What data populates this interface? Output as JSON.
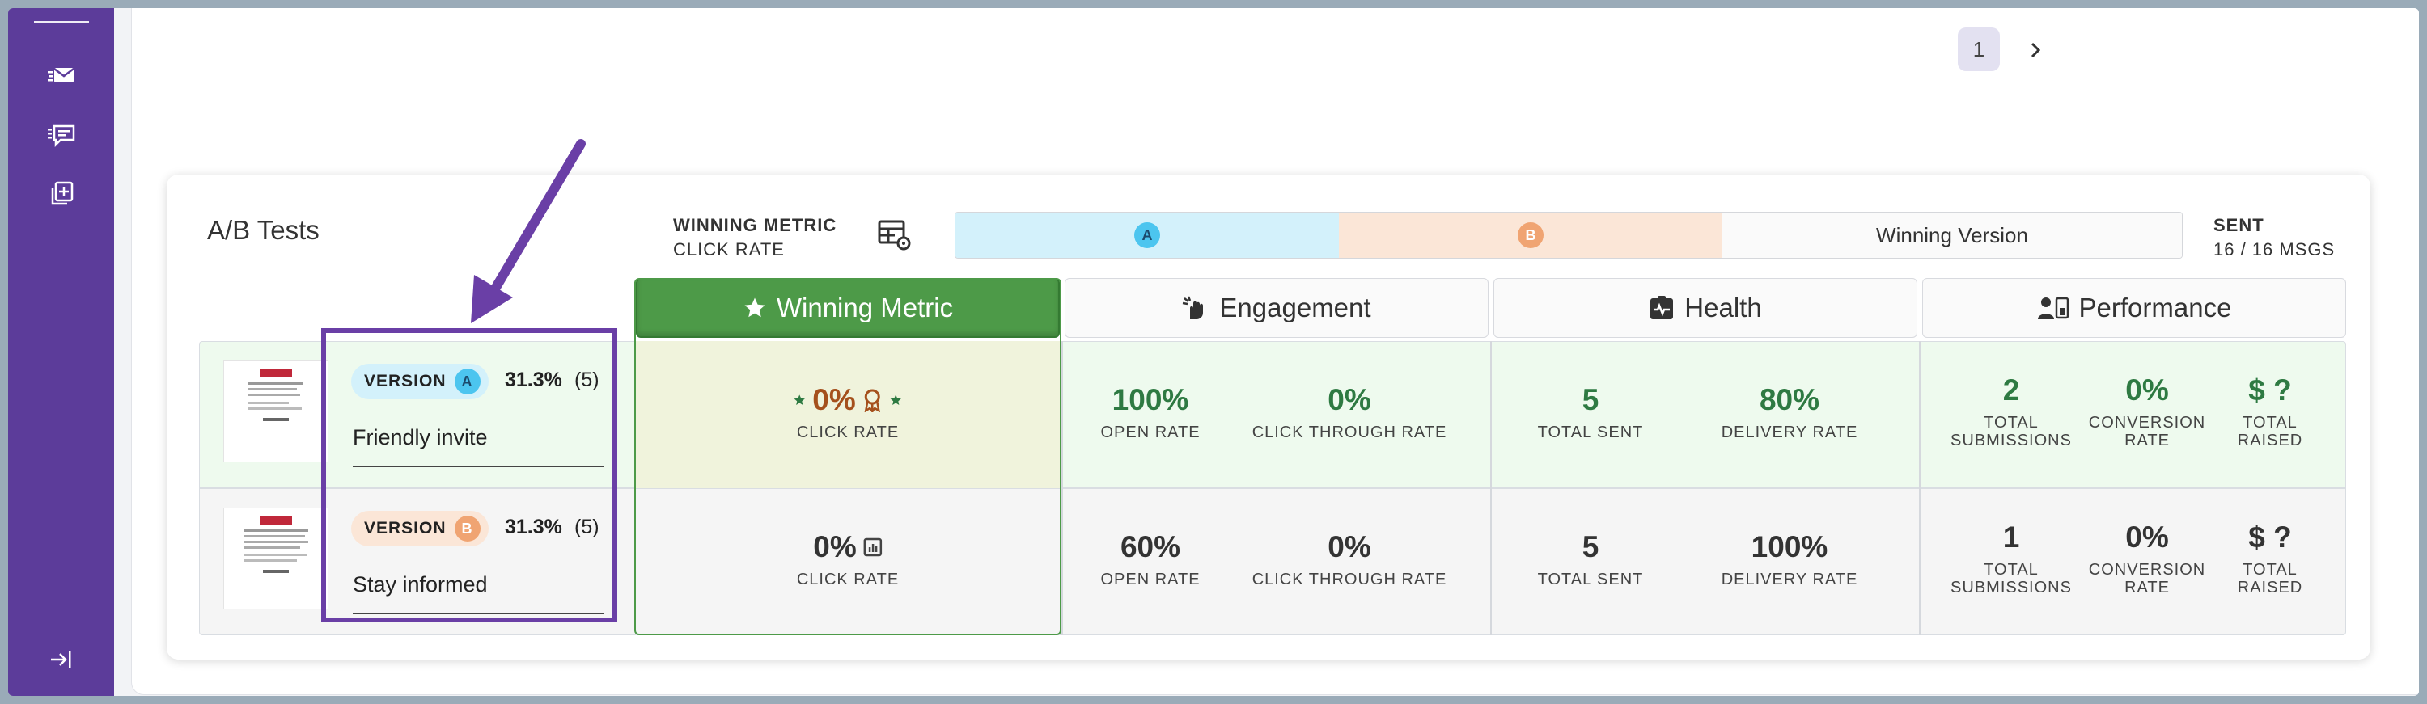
{
  "pagination": {
    "current_page": "1"
  },
  "card": {
    "title": "A/B Tests",
    "winning_metric_label": "WINNING METRIC",
    "winning_metric_value": "CLICK RATE",
    "legend": {
      "a": "A",
      "b": "B",
      "winning": "Winning Version"
    },
    "sent_label": "SENT",
    "sent_value": "16 / 16 MSGS"
  },
  "sections": {
    "winning": "Winning Metric",
    "engagement": "Engagement",
    "health": "Health",
    "performance": "Performance"
  },
  "labels": {
    "click_rate": "CLICK RATE",
    "open_rate": "OPEN RATE",
    "click_through_rate": "CLICK THROUGH RATE",
    "total_sent": "TOTAL SENT",
    "delivery_rate": "DELIVERY RATE",
    "total": "TOTAL",
    "submissions": "SUBMISSIONS",
    "conversion": "CONVERSION",
    "rate": "RATE",
    "raised": "RAISED"
  },
  "versions": [
    {
      "badge": "VERSION",
      "letter": "A",
      "percent": "31.3%",
      "count": "(5)",
      "name": "Friendly invite",
      "click_rate": "0%",
      "open_rate": "100%",
      "ctr": "0%",
      "total_sent": "5",
      "delivery_rate": "80%",
      "submissions": "2",
      "conversion_rate": "0%",
      "total_raised": "$ ?"
    },
    {
      "badge": "VERSION",
      "letter": "B",
      "percent": "31.3%",
      "count": "(5)",
      "name": "Stay informed",
      "click_rate": "0%",
      "open_rate": "60%",
      "ctr": "0%",
      "total_sent": "5",
      "delivery_rate": "100%",
      "submissions": "1",
      "conversion_rate": "0%",
      "total_raised": "$ ?"
    }
  ],
  "colors": {
    "sidebar": "#5c3c9a",
    "winning_header": "#4d9a48",
    "winner_cell": "#f0f3dc",
    "row_a_bg": "#eefaee",
    "row_b_bg": "#f5f5f5",
    "version_a": "#d3f1fb",
    "version_b": "#fbe6d7",
    "annotation": "#6a3fa6",
    "metric_green": "#2e7a42",
    "winner_value": "#a5501c"
  },
  "icons": {
    "sidebar": [
      "email-send-icon",
      "message-list-icon",
      "add-copy-icon",
      "collapse-sidebar-icon"
    ],
    "sections": [
      "star-icon",
      "engagement-hand-icon",
      "health-monitor-icon",
      "performance-person-icon"
    ],
    "winner": "award-ribbon-icon",
    "chart": "bar-chart-icon"
  }
}
